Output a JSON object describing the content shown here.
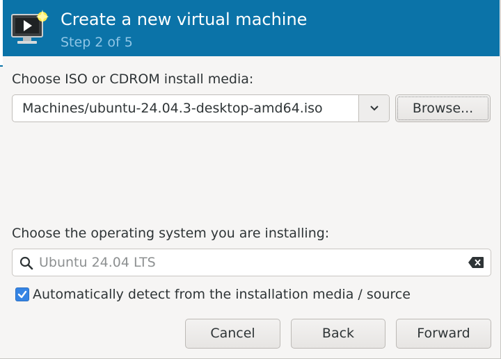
{
  "header": {
    "title": "Create a new virtual machine",
    "subtitle": "Step 2 of 5",
    "icon": "vm-monitor-icon",
    "bg_color": "#0b73a8"
  },
  "install_media": {
    "label": "Choose ISO or CDROM install media:",
    "selected_path": "Machines/ubuntu-24.04.3-desktop-amd64.iso",
    "browse_label": "Browse..."
  },
  "os": {
    "label": "Choose the operating system you are installing:",
    "search_value": "Ubuntu 24.04 LTS",
    "auto_detect_label": "Automatically detect from the installation media / source",
    "auto_detect_checked": true
  },
  "footer": {
    "cancel_label": "Cancel",
    "back_label": "Back",
    "forward_label": "Forward"
  },
  "colors": {
    "accent": "#3584e4"
  }
}
